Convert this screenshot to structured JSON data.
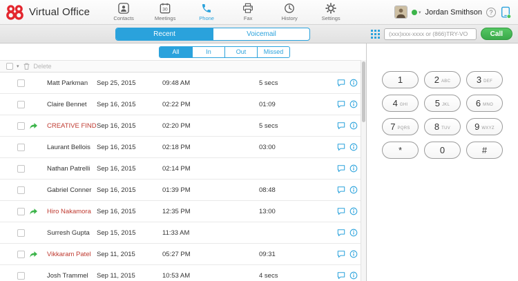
{
  "header": {
    "app_title": "Virtual Office",
    "user": {
      "name": "Jordan Smithson",
      "presence_color": "#3cb44a"
    }
  },
  "nav": {
    "items": [
      {
        "label": "Contacts",
        "icon": "contacts-icon",
        "active": false
      },
      {
        "label": "Meetings",
        "icon": "meetings-icon",
        "active": false,
        "badge": "30"
      },
      {
        "label": "Phone",
        "icon": "phone-icon",
        "active": true
      },
      {
        "label": "Fax",
        "icon": "fax-icon",
        "active": false
      },
      {
        "label": "History",
        "icon": "history-icon",
        "active": false
      },
      {
        "label": "Settings",
        "icon": "settings-icon",
        "active": false
      }
    ]
  },
  "tabs": {
    "items": [
      {
        "label": "Recent",
        "active": true
      },
      {
        "label": "Voicemail",
        "active": false
      }
    ]
  },
  "filters": {
    "items": [
      {
        "label": "All",
        "active": true
      },
      {
        "label": "In",
        "active": false
      },
      {
        "label": "Out",
        "active": false
      },
      {
        "label": "Missed",
        "active": false
      }
    ]
  },
  "list_toolbar": {
    "delete_label": "Delete",
    "icons": [
      "checkbox",
      "caret-down-icon",
      "trash-icon"
    ]
  },
  "calls": [
    {
      "name": "Matt Parkman",
      "date": "Sep 25, 2015",
      "time": "09:48 AM",
      "duration": "5 secs",
      "outgoing": false,
      "highlight": false
    },
    {
      "name": "Claire Bennet",
      "date": "Sep 16, 2015",
      "time": "02:22 PM",
      "duration": "01:09",
      "outgoing": false,
      "highlight": false
    },
    {
      "name": "CREATIVE FIND",
      "date": "Sep 16, 2015",
      "time": "02:20 PM",
      "duration": "5 secs",
      "outgoing": true,
      "highlight": true
    },
    {
      "name": "Laurant Bellois",
      "date": "Sep 16, 2015",
      "time": "02:18 PM",
      "duration": "03:00",
      "outgoing": false,
      "highlight": false
    },
    {
      "name": "Nathan Patrelli",
      "date": "Sep 16, 2015",
      "time": "02:14 PM",
      "duration": "",
      "outgoing": false,
      "highlight": false
    },
    {
      "name": "Gabriel Conner",
      "date": "Sep 16, 2015",
      "time": "01:39 PM",
      "duration": "08:48",
      "outgoing": false,
      "highlight": false
    },
    {
      "name": "Hiro Nakamora",
      "date": "Sep 16, 2015",
      "time": "12:35 PM",
      "duration": "13:00",
      "outgoing": true,
      "highlight": true
    },
    {
      "name": "Surresh Gupta",
      "date": "Sep 15, 2015",
      "time": "11:33 AM",
      "duration": "",
      "outgoing": false,
      "highlight": false
    },
    {
      "name": "Vikkaram Patel",
      "date": "Sep 11, 2015",
      "time": "05:27 PM",
      "duration": "09:31",
      "outgoing": true,
      "highlight": true
    },
    {
      "name": "Josh Trammel",
      "date": "Sep 11, 2015",
      "time": "10:53 AM",
      "duration": "4 secs",
      "outgoing": false,
      "highlight": false
    }
  ],
  "row_icons": [
    "chat-icon",
    "info-icon",
    "outgoing-call-icon"
  ],
  "dialer": {
    "placeholder": "(xxx)xxx-xxxx or (866)TRY-VO",
    "call_label": "Call",
    "toggle_icon": "dialpad-grid-icon"
  },
  "dialpad": {
    "keys": [
      {
        "digit": "1",
        "letters": ""
      },
      {
        "digit": "2",
        "letters": "ABC"
      },
      {
        "digit": "3",
        "letters": "DEF"
      },
      {
        "digit": "4",
        "letters": "GHI"
      },
      {
        "digit": "5",
        "letters": "JKL"
      },
      {
        "digit": "6",
        "letters": "MNO"
      },
      {
        "digit": "7",
        "letters": "PQRS"
      },
      {
        "digit": "8",
        "letters": "TUV"
      },
      {
        "digit": "9",
        "letters": "WXYZ"
      },
      {
        "digit": "*",
        "letters": ""
      },
      {
        "digit": "0",
        "letters": ""
      },
      {
        "digit": "#",
        "letters": ""
      }
    ]
  },
  "colors": {
    "accent_blue": "#2aa2dc",
    "call_green": "#3cb44a",
    "highlight_red": "#bf3a30",
    "logo_red": "#e3262e"
  }
}
